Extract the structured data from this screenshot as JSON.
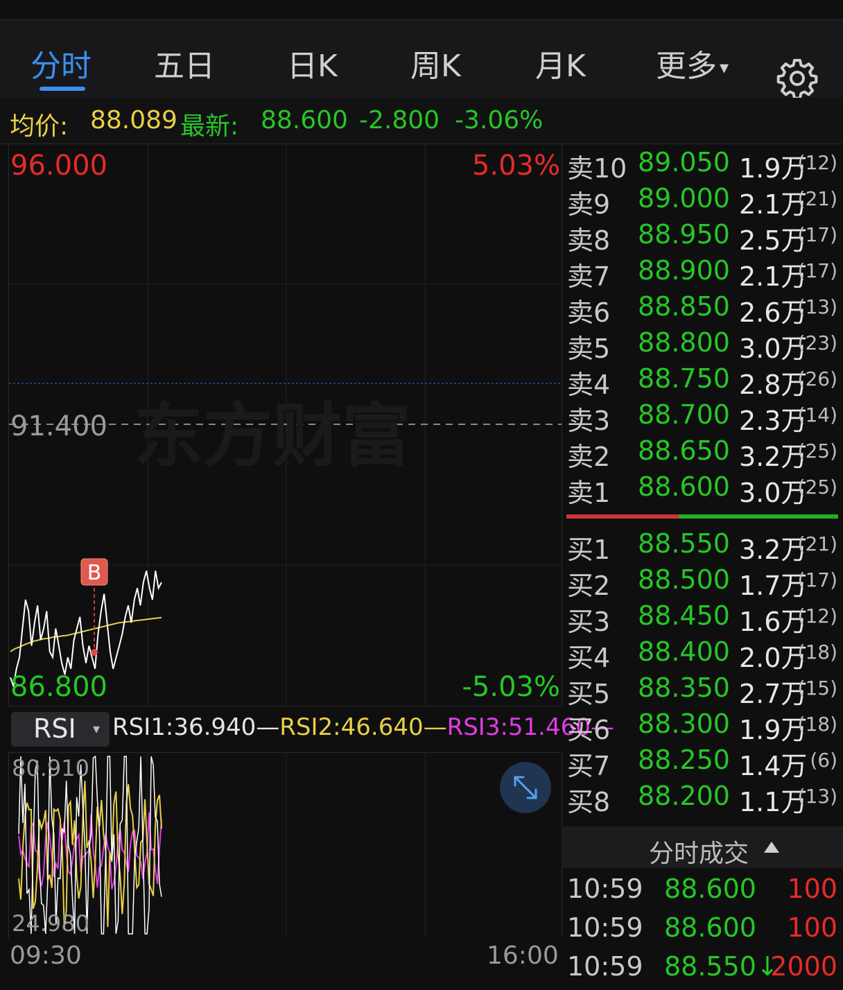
{
  "tabs": [
    {
      "label": "分时",
      "active": true
    },
    {
      "label": "五日"
    },
    {
      "label": "日K"
    },
    {
      "label": "周K"
    },
    {
      "label": "月K"
    },
    {
      "label": "更多"
    }
  ],
  "more_caret": "▾",
  "info": {
    "avg_label": "均价:",
    "avg_value": "88.089",
    "latest_label": "最新:",
    "latest_value": "88.600",
    "change": "-2.800",
    "change_pct": "-3.06%"
  },
  "chart": {
    "y_top": "96.000",
    "y_mid": "91.400",
    "y_bottom": "86.800",
    "pct_top": "5.03%",
    "pct_bottom": "-5.03%",
    "watermark": "东方财富",
    "buy_marker": "B",
    "x_start": "09:30",
    "x_end": "16:00"
  },
  "chart_data": {
    "type": "line",
    "ylim": [
      86.8,
      96.0
    ],
    "series": [
      {
        "values": [
          87.05,
          86.9,
          87.2,
          87.4,
          87.9,
          88.4,
          88.2,
          87.6,
          88.0,
          88.3,
          87.7,
          87.9,
          88.2,
          87.5,
          87.4,
          87.9,
          87.6,
          87.3,
          87.1,
          87.4,
          87.2,
          87.7,
          87.9,
          88.1,
          87.6,
          87.3,
          87.6,
          87.4,
          87.2,
          87.8,
          88.2,
          88.5,
          88.0,
          87.5,
          87.2,
          87.4,
          87.6,
          87.8,
          88.1,
          88.3,
          88.0,
          88.4,
          88.6,
          88.3,
          88.7,
          88.9,
          88.6,
          88.4,
          88.9,
          88.6,
          88.7
        ]
      },
      {
        "values": [
          87.5,
          87.55,
          87.58,
          87.62,
          87.65,
          87.68,
          87.7,
          87.72,
          87.73,
          87.75,
          87.76,
          87.77,
          87.78,
          87.8,
          87.82,
          87.84,
          87.86,
          87.88,
          87.9,
          87.92,
          87.94,
          87.96,
          87.98,
          88.0,
          88.01,
          88.02,
          88.03,
          88.04,
          88.05,
          88.06,
          88.07,
          88.08,
          88.089
        ]
      }
    ]
  },
  "rsi": {
    "select_label": "RSI",
    "rsi1": "RSI1:36.940",
    "rsi2": "RSI2:46.640",
    "rsi3": "RSI3:51.460",
    "dash": "—",
    "y_top": "80.910",
    "y_bottom": "24.980"
  },
  "order_book": {
    "sell": [
      {
        "label": "卖10",
        "price": "89.050",
        "vol": "1.9万",
        "count": "(12)"
      },
      {
        "label": "卖9",
        "price": "89.000",
        "vol": "2.1万",
        "count": "(21)"
      },
      {
        "label": "卖8",
        "price": "88.950",
        "vol": "2.5万",
        "count": "(17)"
      },
      {
        "label": "卖7",
        "price": "88.900",
        "vol": "2.1万",
        "count": "(17)"
      },
      {
        "label": "卖6",
        "price": "88.850",
        "vol": "2.6万",
        "count": "(13)"
      },
      {
        "label": "卖5",
        "price": "88.800",
        "vol": "3.0万",
        "count": "(23)"
      },
      {
        "label": "卖4",
        "price": "88.750",
        "vol": "2.8万",
        "count": "(26)"
      },
      {
        "label": "卖3",
        "price": "88.700",
        "vol": "2.3万",
        "count": "(14)"
      },
      {
        "label": "卖2",
        "price": "88.650",
        "vol": "3.2万",
        "count": "(25)"
      },
      {
        "label": "卖1",
        "price": "88.600",
        "vol": "3.0万",
        "count": "(25)"
      }
    ],
    "buy": [
      {
        "label": "买1",
        "price": "88.550",
        "vol": "3.2万",
        "count": "(21)"
      },
      {
        "label": "买2",
        "price": "88.500",
        "vol": "1.7万",
        "count": "(17)"
      },
      {
        "label": "买3",
        "price": "88.450",
        "vol": "1.6万",
        "count": "(12)"
      },
      {
        "label": "买4",
        "price": "88.400",
        "vol": "2.0万",
        "count": "(18)"
      },
      {
        "label": "买5",
        "price": "88.350",
        "vol": "2.7万",
        "count": "(15)"
      },
      {
        "label": "买6",
        "price": "88.300",
        "vol": "1.9万",
        "count": "(18)"
      },
      {
        "label": "买7",
        "price": "88.250",
        "vol": "1.4万",
        "count": "(6)"
      },
      {
        "label": "买8",
        "price": "88.200",
        "vol": "1.1万",
        "count": "(13)"
      }
    ]
  },
  "trades": {
    "header": "分时成交",
    "rows": [
      {
        "time": "10:59",
        "price": "88.600",
        "vol": "100"
      },
      {
        "time": "10:59",
        "price": "88.600",
        "vol": "100"
      },
      {
        "time": "10:59",
        "price": "88.550↓",
        "vol": "2000"
      }
    ]
  },
  "colors": {
    "accent": "#3d8ff2",
    "up": "#e82a2a",
    "down": "#27c627",
    "avg": "#e8d046",
    "rsi3": "#e23ce6"
  }
}
